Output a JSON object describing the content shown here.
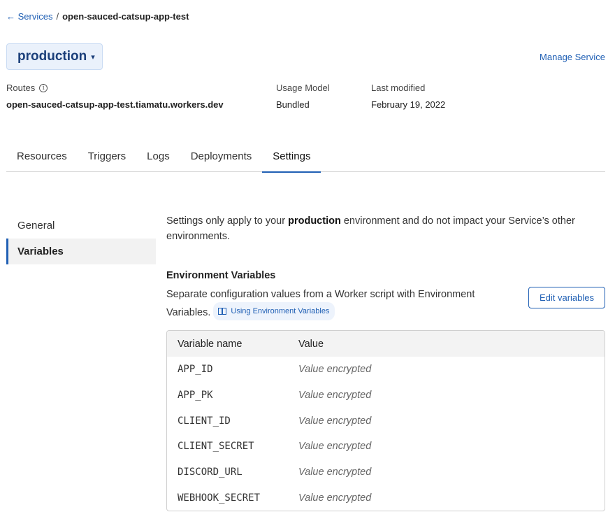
{
  "breadcrumb": {
    "back_link": "← Services",
    "separator": "/",
    "current": "open-sauced-catsup-app-test"
  },
  "environment": {
    "label": "production",
    "caret": "▾"
  },
  "manage_service": "Manage Service",
  "meta": {
    "routes_label": "Routes",
    "routes_info_icon": "i",
    "routes_value": "open-sauced-catsup-app-test.tiamatu.workers.dev",
    "usage_label": "Usage Model",
    "usage_value": "Bundled",
    "modified_label": "Last modified",
    "modified_value": "February 19, 2022"
  },
  "tabs": [
    {
      "label": "Resources"
    },
    {
      "label": "Triggers"
    },
    {
      "label": "Logs"
    },
    {
      "label": "Deployments"
    },
    {
      "label": "Settings",
      "active": true
    }
  ],
  "side_nav": [
    {
      "label": "General"
    },
    {
      "label": "Variables",
      "active": true
    }
  ],
  "settings": {
    "intro_prefix": "Settings only apply to your ",
    "intro_env": "production",
    "intro_suffix": " environment and do not impact your Service’s other environments.",
    "section_title": "Environment Variables",
    "section_desc": "Separate configuration values from a Worker script with Environment Variables.",
    "doc_link": "Using Environment Variables",
    "edit_button": "Edit variables"
  },
  "variables_table": {
    "headers": {
      "name": "Variable name",
      "value": "Value"
    },
    "rows": [
      {
        "name": "APP_ID",
        "value": "Value encrypted"
      },
      {
        "name": "APP_PK",
        "value": "Value encrypted"
      },
      {
        "name": "CLIENT_ID",
        "value": "Value encrypted"
      },
      {
        "name": "CLIENT_SECRET",
        "value": "Value encrypted"
      },
      {
        "name": "DISCORD_URL",
        "value": "Value encrypted"
      },
      {
        "name": "WEBHOOK_SECRET",
        "value": "Value encrypted"
      }
    ]
  },
  "colors": {
    "accent": "#1f5fb4",
    "env_button_bg": "#eaf1fb",
    "table_header_bg": "#f3f3f3"
  },
  "icons": {
    "back": "arrow-left-icon",
    "caret": "chevron-down-icon",
    "info": "info-circle-icon",
    "doc": "book-icon"
  }
}
